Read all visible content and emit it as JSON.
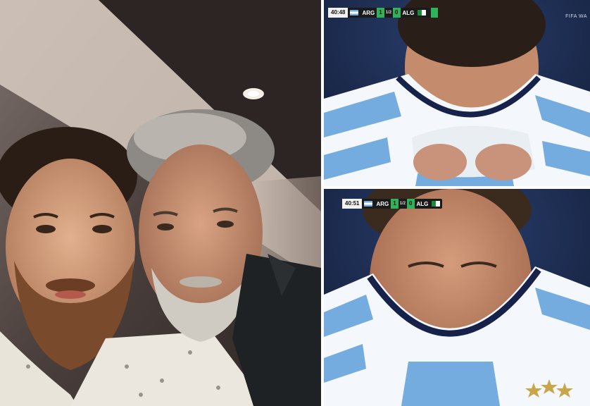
{
  "left_photo": {
    "description_icon": "selfie-photo"
  },
  "top_right": {
    "clock": "40:48",
    "home": "ARG",
    "home_score": "1",
    "away_score": "0",
    "away": "ALG",
    "mid": "1/2",
    "watermark": "FIFA WA"
  },
  "bottom_right": {
    "clock": "40:51",
    "home": "ARG",
    "home_score": "1",
    "away_score": "0",
    "away": "ALG",
    "mid": "1/2"
  },
  "colors": {
    "jersey_blue": "#74acdf",
    "score_green": "#2fb35a"
  }
}
